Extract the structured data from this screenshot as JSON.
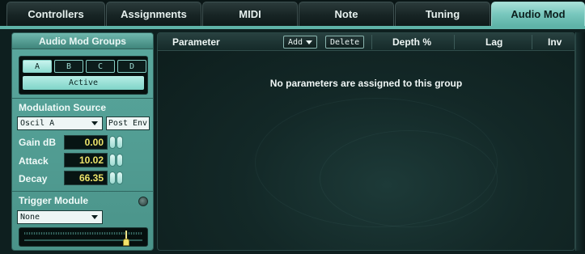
{
  "tabs": [
    {
      "label": "Controllers",
      "active": false
    },
    {
      "label": "Assignments",
      "active": false
    },
    {
      "label": "MIDI",
      "active": false
    },
    {
      "label": "Note",
      "active": false
    },
    {
      "label": "Tuning",
      "active": false
    },
    {
      "label": "Audio Mod",
      "active": true
    }
  ],
  "groups": {
    "header": "Audio Mod Groups",
    "buttons": [
      "A",
      "B",
      "C",
      "D"
    ],
    "selected": "A",
    "active_label": "Active"
  },
  "modulation_source": {
    "title": "Modulation Source",
    "source_value": "Oscil A",
    "post_env_label": "Post Env"
  },
  "params": [
    {
      "label": "Gain dB",
      "value": "0.00"
    },
    {
      "label": "Attack",
      "value": "10.02"
    },
    {
      "label": "Decay",
      "value": "66.35"
    }
  ],
  "trigger": {
    "title": "Trigger Module",
    "value": "None",
    "slider_level": 0.86
  },
  "table": {
    "col_parameter": "Parameter",
    "add_label": "Add",
    "delete_label": "Delete",
    "col_depth": "Depth %",
    "col_lag": "Lag",
    "col_inv": "Inv",
    "empty_message": "No parameters are assigned to this group"
  },
  "colors": {
    "accent": "#78c7bd",
    "value_text": "#ece36a",
    "background": "#0e1f1f"
  }
}
